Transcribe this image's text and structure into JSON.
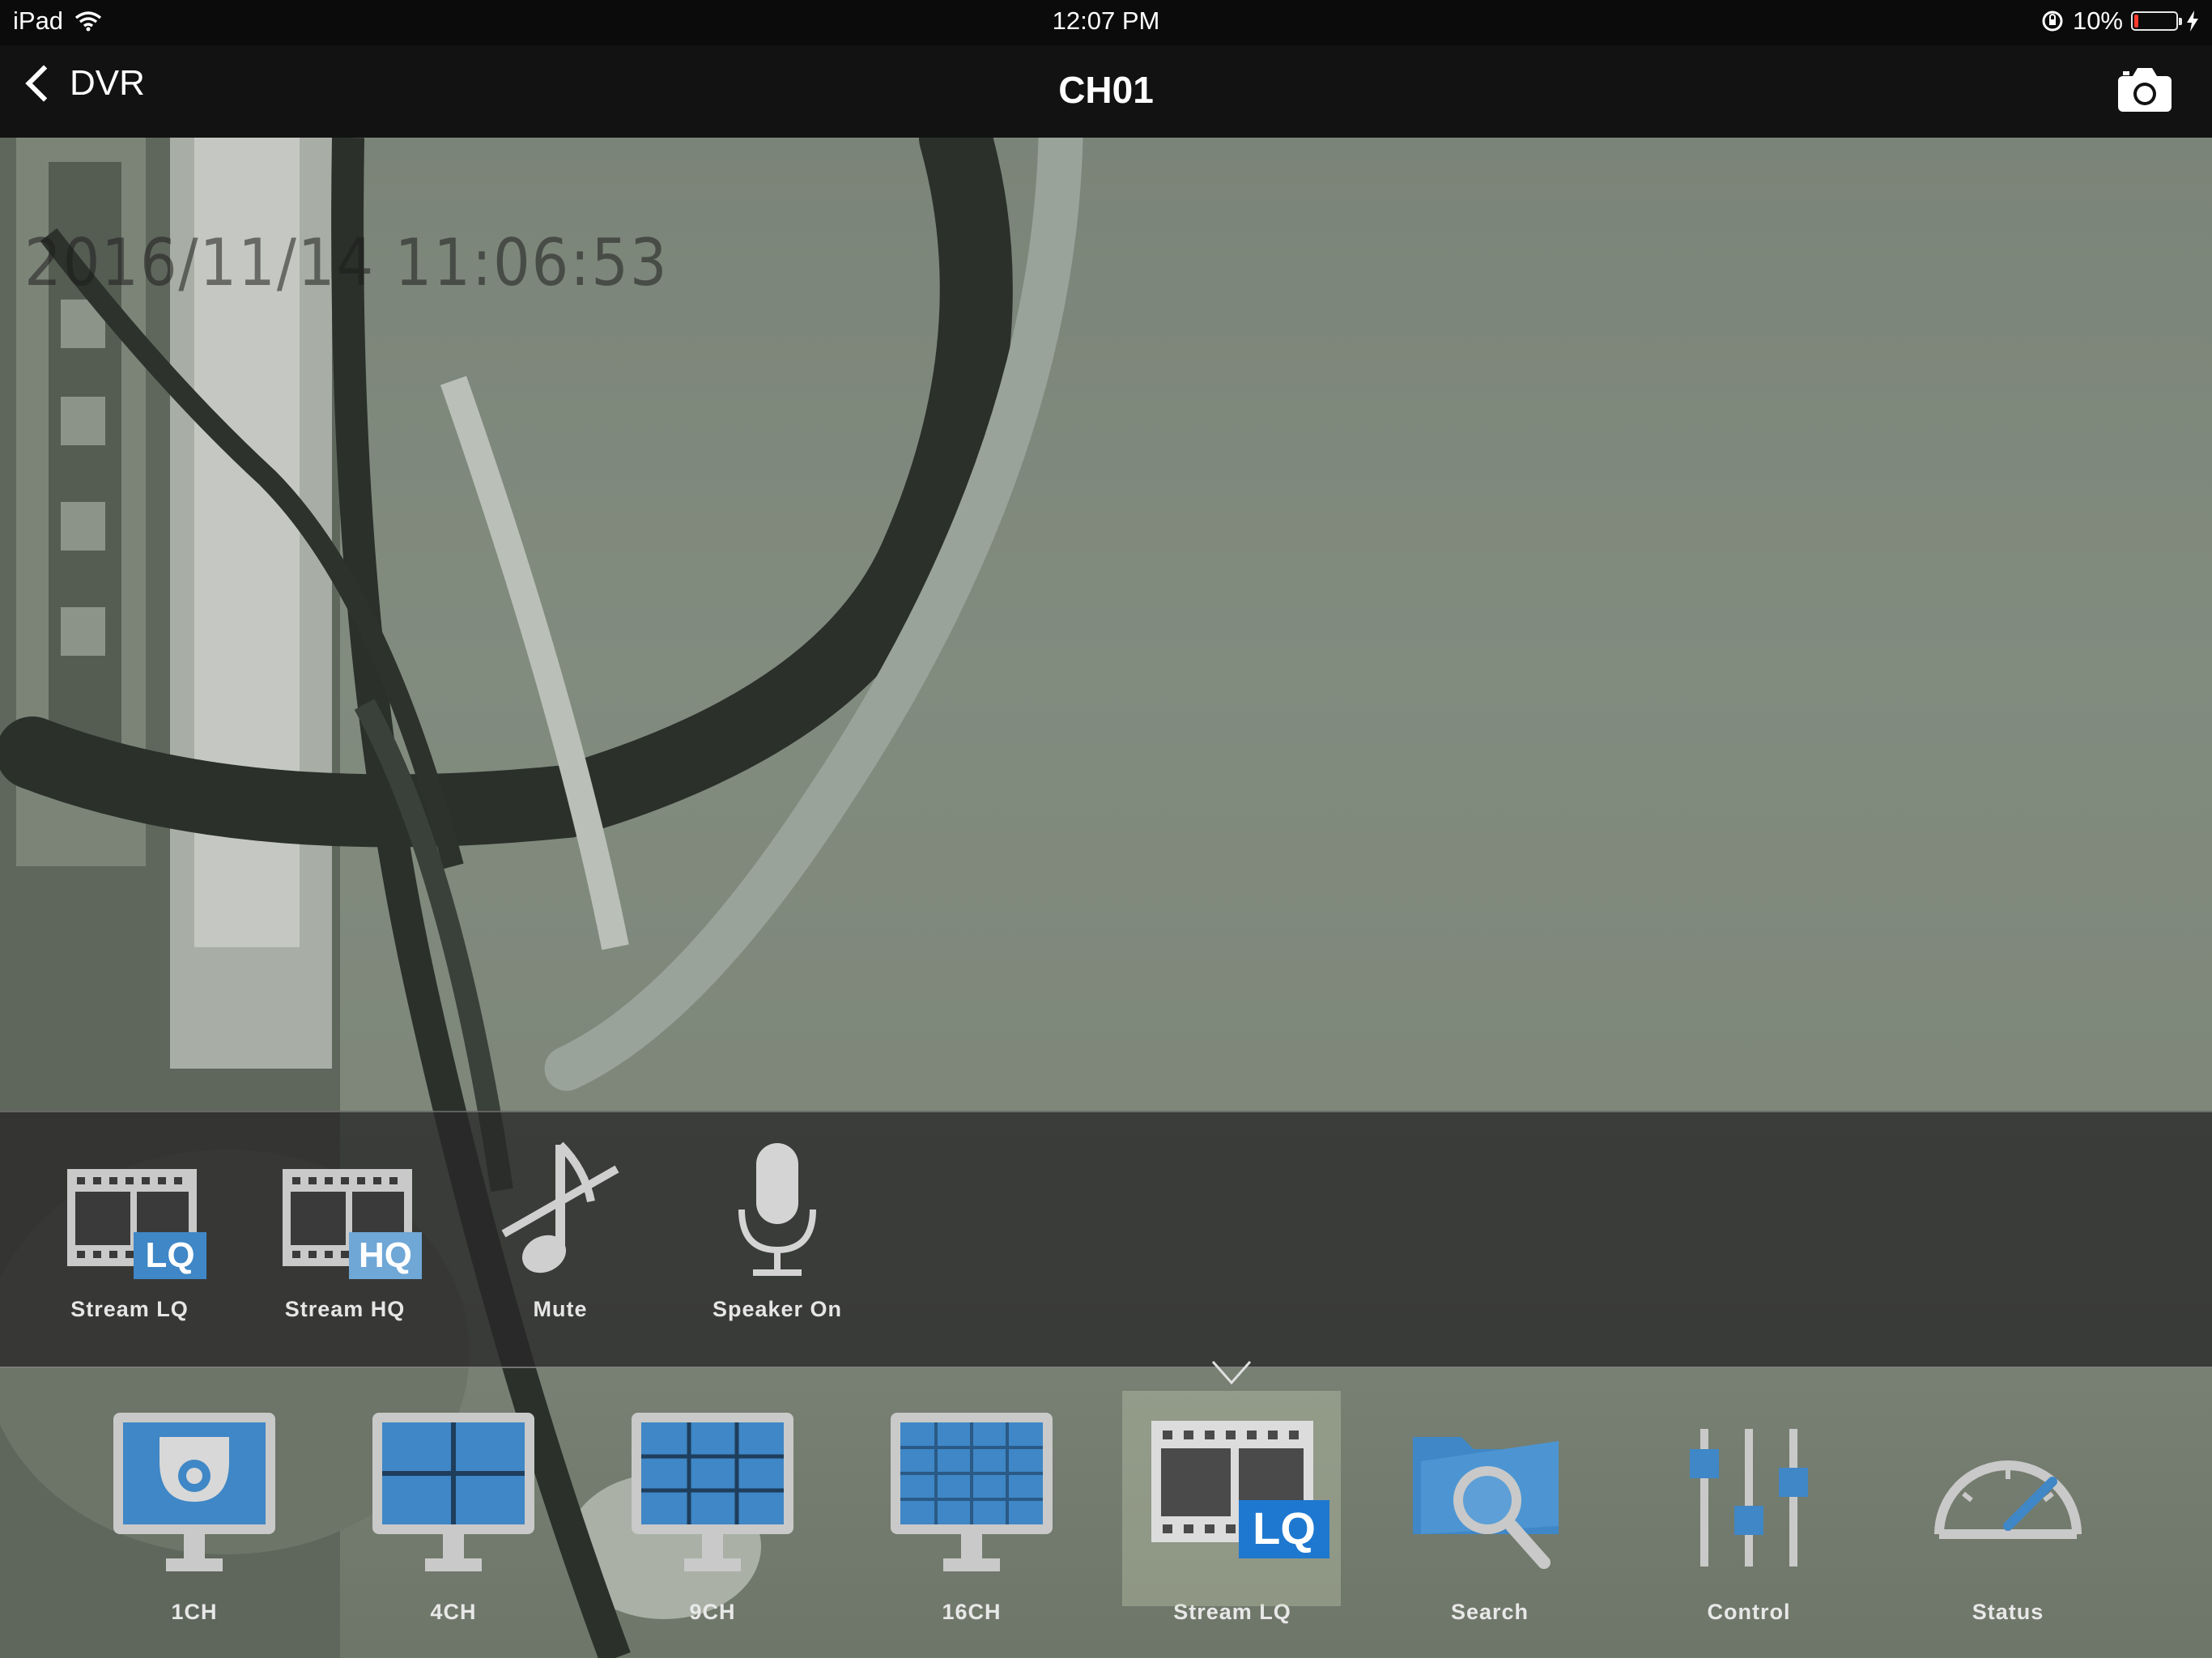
{
  "status_bar": {
    "device": "iPad",
    "time": "12:07 PM",
    "battery_percent": "10%",
    "battery_level": 0.1,
    "battery_color": "#ff3b30"
  },
  "nav": {
    "back_label": "DVR",
    "title": "CH01"
  },
  "video": {
    "osd_timestamp": "2016/11/14 11:06:53"
  },
  "sub_toolbar": {
    "items": [
      {
        "label": "Stream LQ",
        "icon": "film-lq-icon"
      },
      {
        "label": "Stream HQ",
        "icon": "film-hq-icon"
      },
      {
        "label": "Mute",
        "icon": "muted-note-icon"
      },
      {
        "label": "Speaker On",
        "icon": "microphone-icon"
      }
    ]
  },
  "tab_bar": {
    "active_index": 4,
    "items": [
      {
        "label": "1CH",
        "icon": "single-camera-monitor-icon"
      },
      {
        "label": "4CH",
        "icon": "quad-monitor-icon"
      },
      {
        "label": "9CH",
        "icon": "nine-grid-monitor-icon"
      },
      {
        "label": "16CH",
        "icon": "sixteen-grid-monitor-icon"
      },
      {
        "label": "Stream LQ",
        "icon": "film-lq-icon"
      },
      {
        "label": "Search",
        "icon": "folder-search-icon"
      },
      {
        "label": "Control",
        "icon": "sliders-icon"
      },
      {
        "label": "Status",
        "icon": "gauge-icon"
      }
    ]
  },
  "colors": {
    "accent_blue": "#3f87c6",
    "icon_gray": "#c9c9c9"
  }
}
